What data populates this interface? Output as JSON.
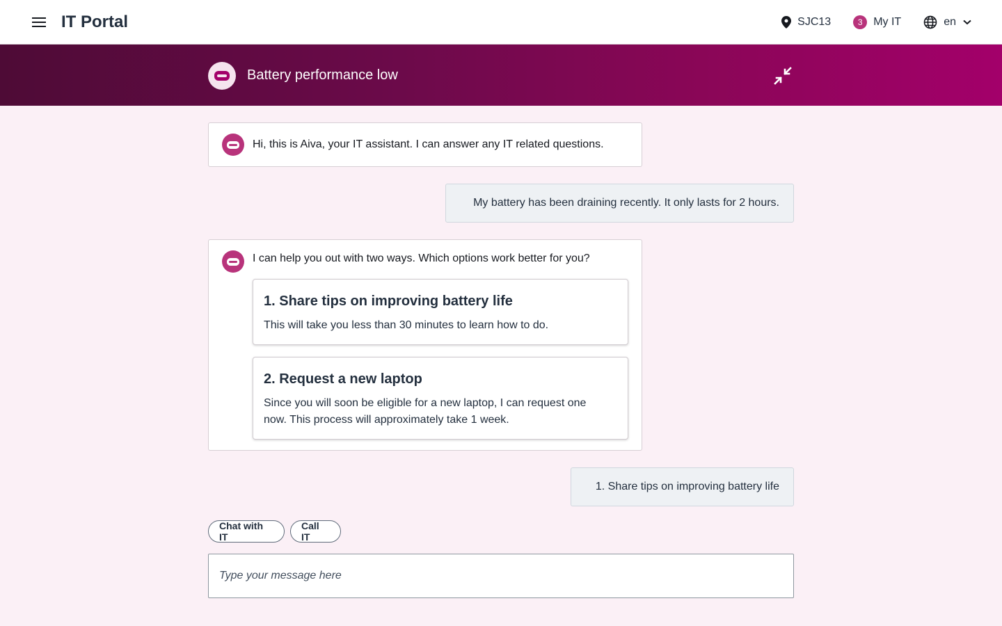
{
  "header": {
    "brand": "IT Portal",
    "location": "SJC13",
    "my_it_count": "3",
    "my_it_label": "My IT",
    "language": "en"
  },
  "banner": {
    "title": "Battery performance low"
  },
  "conversation": {
    "bot_greeting": "Hi, this is Aiva, your IT assistant. I can answer any IT related questions.",
    "user_message_1": "My battery has been draining recently. It only lasts for 2 hours.",
    "bot_options_prompt": "I can help you out with two ways. Which options work better for you?",
    "options": [
      {
        "title": "1. Share tips on improving battery life",
        "description": "This will take you less than 30 minutes to learn how to do."
      },
      {
        "title": "2. Request a new laptop",
        "description": "Since you will soon be eligible for a new laptop, I can request one now. This process will approximately take 1 week."
      }
    ],
    "user_message_2": "1. Share tips on improving battery life"
  },
  "actions": {
    "chat_label": "Chat with IT",
    "call_label": "Call IT"
  },
  "composer": {
    "placeholder": "Type your message here"
  },
  "colors": {
    "accent": "#b8337b",
    "banner_start": "#4e0b36",
    "banner_end": "#a3006a",
    "background": "#fbf0f6"
  },
  "icons": {
    "menu": "hamburger-icon",
    "location": "map-pin-icon",
    "language": "globe-icon",
    "dropdown": "chevron-down-icon",
    "collapse": "collapse-arrows-icon",
    "assistant": "robot-icon"
  }
}
